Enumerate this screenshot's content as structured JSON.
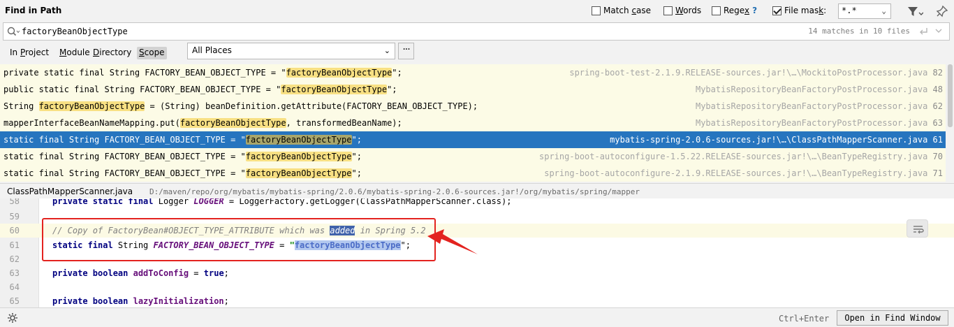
{
  "header": {
    "title": "Find in Path",
    "options": {
      "match_case": {
        "pre": "Match ",
        "key": "c",
        "post": "ase",
        "checked": false
      },
      "words": {
        "pre": "",
        "key": "W",
        "post": "ords",
        "checked": false
      },
      "regex": {
        "pre": "Rege",
        "key": "x",
        "post": "",
        "help": "?",
        "checked": false
      },
      "file_mask": {
        "pre": "File mas",
        "key": "k",
        "post": ":",
        "checked": true,
        "value": "*.*"
      }
    }
  },
  "search": {
    "query": "factoryBeanObjectType",
    "matches": "14 matches in 10 files"
  },
  "scope": {
    "tabs": [
      {
        "pre": "In ",
        "key": "P",
        "post": "roject"
      },
      {
        "pre": "",
        "key": "M",
        "post": "odule"
      },
      {
        "pre": "",
        "key": "D",
        "post": "irectory"
      },
      {
        "pre": "",
        "key": "S",
        "post": "cope"
      }
    ],
    "places": "All Places",
    "more": "···"
  },
  "results": [
    {
      "pre": "private static final String FACTORY_BEAN_OBJECT_TYPE = \"",
      "match": "factoryBeanObjectType",
      "post": "\";",
      "file": "spring-boot-test-2.1.9.RELEASE-sources.jar!\\…\\MockitoPostProcessor.java",
      "line": "82"
    },
    {
      "pre": "public static final String FACTORY_BEAN_OBJECT_TYPE = \"",
      "match": "factoryBeanObjectType",
      "post": "\";",
      "file": "MybatisRepositoryBeanFactoryPostProcessor.java",
      "line": "48"
    },
    {
      "pre": "String ",
      "match": "factoryBeanObjectType",
      "post": " = (String) beanDefinition.getAttribute(FACTORY_BEAN_OBJECT_TYPE);",
      "file": "MybatisRepositoryBeanFactoryPostProcessor.java",
      "line": "62"
    },
    {
      "pre": "mapperInterfaceBeanNameMapping.put(",
      "match": "factoryBeanObjectType",
      "post": ", transformedBeanName);",
      "file": "MybatisRepositoryBeanFactoryPostProcessor.java",
      "line": "63"
    },
    {
      "pre": "static final String FACTORY_BEAN_OBJECT_TYPE = \"",
      "match": "factoryBeanObjectType",
      "post": "\";",
      "file": "mybatis-spring-2.0.6-sources.jar!\\…\\ClassPathMapperScanner.java",
      "line": "61"
    },
    {
      "pre": "static final String FACTORY_BEAN_OBJECT_TYPE = \"",
      "match": "factoryBeanObjectType",
      "post": "\";",
      "file": "spring-boot-autoconfigure-1.5.22.RELEASE-sources.jar!\\…\\BeanTypeRegistry.java",
      "line": "70"
    },
    {
      "pre": "static final String FACTORY_BEAN_OBJECT_TYPE = \"",
      "match": "factoryBeanObjectType",
      "post": "\";",
      "file": "spring-boot-autoconfigure-2.1.9.RELEASE-sources.jar!\\…\\BeanTypeRegistry.java",
      "line": "71"
    }
  ],
  "preview": {
    "file_name": "ClassPathMapperScanner.java",
    "file_path": "D:/maven/repo/org/mybatis/mybatis-spring/2.0.6/mybatis-spring-2.0.6-sources.jar!/org/mybatis/spring/mapper",
    "lines": {
      "l58": {
        "num": "58",
        "kw": "private static final",
        "type": " Logger ",
        "const": "LOGGER",
        "rest": " = LoggerFactory.getLogger(ClassPathMapperScanner.class);"
      },
      "l59": {
        "num": "59"
      },
      "l60": {
        "num": "60",
        "c1": "// Copy of FactoryBean#OBJECT_TYPE_ATTRIBUTE which was ",
        "sel": "added",
        "c2": " in Spring 5.2"
      },
      "l61": {
        "num": "61",
        "kw": "static final",
        "type": " String ",
        "const": "FACTORY_BEAN_OBJECT_TYPE",
        "eq": " = ",
        "q1": "\"",
        "str": "factoryBeanObjectType",
        "q2": "\";"
      },
      "l62": {
        "num": "62"
      },
      "l63": {
        "num": "63",
        "kw": "private boolean",
        "fn": " addToConfig",
        "eq": " = ",
        "val": "true",
        "end": ";"
      },
      "l64": {
        "num": "64"
      },
      "l65": {
        "num": "65",
        "kw": "private boolean",
        "fn": " lazyInitialization",
        "end": ";"
      }
    }
  },
  "footer": {
    "shortcut": "Ctrl+Enter",
    "open_button": "Open in Find Window"
  },
  "colors": {
    "selection": "#2675bf",
    "match_highlight": "#f8e083",
    "annotation": "#e3231f"
  }
}
